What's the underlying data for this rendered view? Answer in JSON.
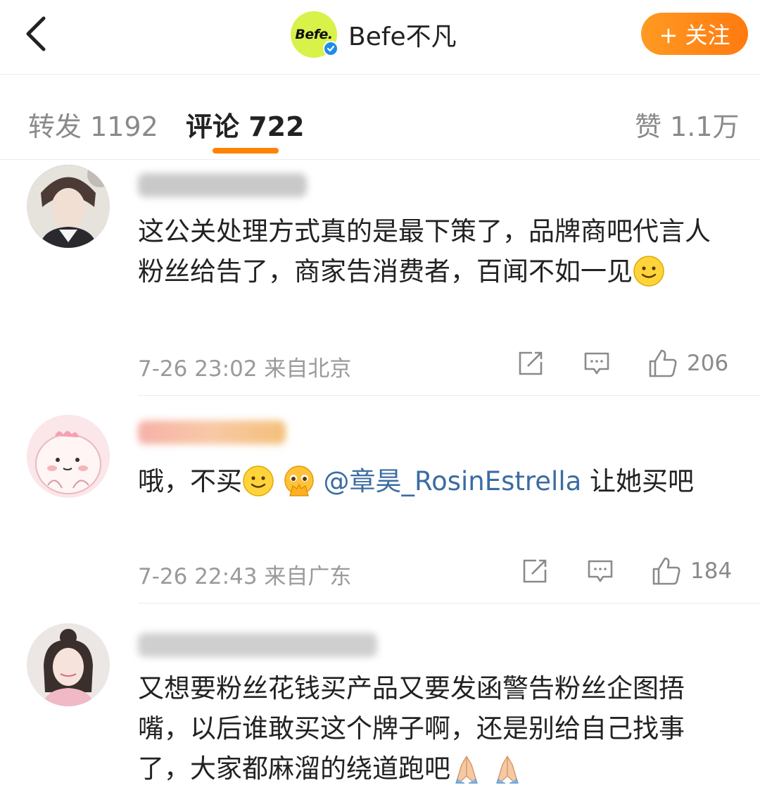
{
  "header": {
    "logo_text": "Befe.",
    "account_name": "Befe不凡",
    "follow_label": "+ 关注"
  },
  "tabs": {
    "reposts": "转发 1192",
    "comments": "评论 722",
    "likes": "赞 1.1万"
  },
  "comments": [
    {
      "text": "这公关处理方式真的是最下策了，品牌商吧代言人粉丝给告了，商家告消费者，百闻不如一见",
      "time": "7-26 23:02",
      "location": "来自北京",
      "likes": "206"
    },
    {
      "text_before": "哦，不买",
      "mention": "@章昊_RosinEstrella",
      "text_after": " 让她买吧",
      "time": "7-26 22:43",
      "location": "来自广东",
      "likes": "184"
    },
    {
      "text": "又想要粉丝花钱买产品又要发函警告粉丝企图捂嘴，以后谁敢买这个牌子啊，还是别给自己找事了，大家都麻溜的绕道跑吧"
    }
  ],
  "colors": {
    "accent": "#ff8200",
    "mention": "#3b6ca3",
    "muted": "#9a9a9a"
  }
}
